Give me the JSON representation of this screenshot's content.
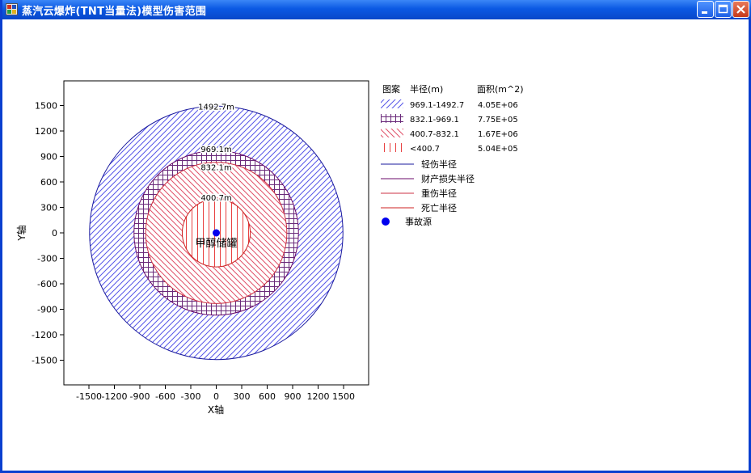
{
  "window": {
    "title": "蒸汽云爆炸(TNT当量法)模型伤害范围"
  },
  "chart_data": {
    "type": "scatter",
    "xlabel": "X轴",
    "ylabel": "Y轴",
    "xlim": [
      -1800,
      1800
    ],
    "ylim": [
      -1800,
      1800
    ],
    "x_ticks": [
      -1500,
      -1200,
      -900,
      -600,
      -300,
      0,
      300,
      600,
      900,
      1200,
      1500
    ],
    "y_ticks": [
      1500,
      1200,
      900,
      600,
      300,
      0,
      -300,
      -600,
      -900,
      -1200,
      -1500
    ],
    "grid": false,
    "legend_position": "right",
    "circles": [
      {
        "label": "1492.7m",
        "radius": 1492.7,
        "color": "#1a1a9e",
        "fill": "#5555e8",
        "pattern": "diag-right"
      },
      {
        "label": "969.1m",
        "radius": 969.1,
        "color": "#6a0a6a",
        "fill": "#6a2a7a",
        "pattern": "grid"
      },
      {
        "label": "832.1m",
        "radius": 832.1,
        "color": "#cc3344",
        "fill": "#e05068",
        "pattern": "diag-left"
      },
      {
        "label": "400.7m",
        "radius": 400.7,
        "color": "#cc2222",
        "fill": "#e84040",
        "pattern": "vertical"
      }
    ],
    "source": {
      "x": 0,
      "y": 0,
      "label": "甲醇储罐",
      "color": "#0000ee"
    },
    "legend": {
      "headers": {
        "pattern": "图案",
        "radius": "半径(m)",
        "area": "面积(m^2)"
      },
      "zones": [
        {
          "range": "969.1-1492.7",
          "area": "4.05E+06",
          "pattern": "diag-right",
          "color": "#5555e8"
        },
        {
          "range": "832.1-969.1",
          "area": "7.75E+05",
          "pattern": "grid",
          "color": "#6a2a7a"
        },
        {
          "range": "400.7-832.1",
          "area": "1.67E+06",
          "pattern": "diag-left",
          "color": "#e05068"
        },
        {
          "range": "<400.7",
          "area": "5.04E+05",
          "pattern": "vertical",
          "color": "#e84040"
        }
      ],
      "lines": [
        {
          "label": "轻伤半径",
          "color": "#1a1a9e"
        },
        {
          "label": "财产损失半径",
          "color": "#6a0a6a"
        },
        {
          "label": "重伤半径",
          "color": "#cc3344"
        },
        {
          "label": "死亡半径",
          "color": "#cc2222"
        }
      ],
      "marker_label": "事故源"
    }
  }
}
